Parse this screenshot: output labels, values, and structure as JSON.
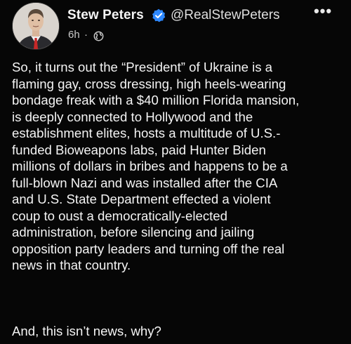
{
  "post": {
    "author_name": "Stew Peters",
    "author_handle": "@RealStewPeters",
    "timestamp": "6h",
    "separator": "·",
    "audience_icon": "globe-icon",
    "more_icon": "more-options-icon",
    "more_label": "•••",
    "body_lines": [
      "So, it turns out the “President” of Ukraine is a",
      "flaming gay, cross dressing, high heels-wearing",
      "bondage freak with a $40 million Florida mansion,",
      "is deeply connected to Hollywood and the",
      "establishment elites, hosts a multitude of U.S.-",
      "funded Bioweapons labs, paid Hunter Biden",
      "millions of dollars in bribes and happens to be a",
      "full-blown Nazi and was installed after the CIA",
      "and U.S. State Department effected a violent",
      "coup to oust a democratically-elected",
      "administration, before silencing and jailing",
      "opposition party leaders and turning off the real",
      "news in that country."
    ],
    "closing_line": "And, this isn’t news, why?"
  },
  "colors": {
    "background": "#060606",
    "text": "#f4f4f4",
    "verified_badge": "#2d88ff"
  }
}
